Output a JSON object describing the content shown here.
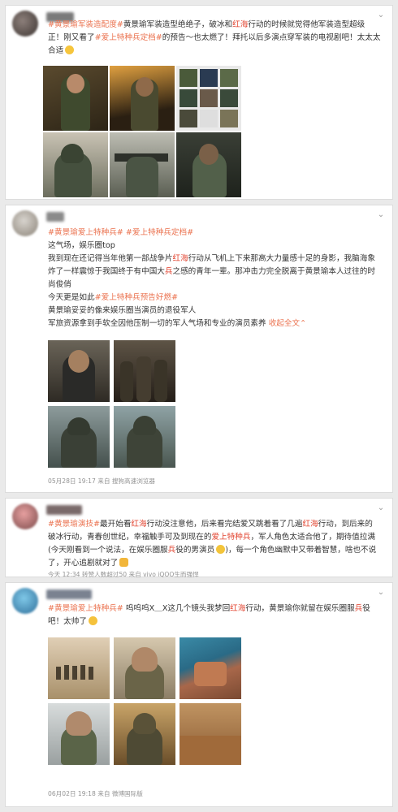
{
  "posts": [
    {
      "line1_tail": "黄景瑜军装造型绝绝子，破冰和",
      "line1_hl": "红海",
      "line1_end": "行动的时候就觉得他军装造型超级",
      "line2_pre": "正！刚又看了",
      "line2_tag": "#爱上特种兵定档#",
      "line2_post": "的预告～也太燃了！拜托以后多演点穿军装的电视剧吧！太太太",
      "line3": "合适",
      "tag1": "#黄景瑜军装造配度#"
    },
    {
      "tags": "#黄景瑜爱上特种兵# #爱上特种兵定档#",
      "l2": "这气场，娱乐圈top",
      "l3a": "我到现在还记得当年他第一部战争片",
      "l3hl": "红海",
      "l3b": "行动从飞机上下来那高大力量感十足的身影，我脑海象",
      "l4a": "炸了一样震惊于我国终于有中国大",
      "l4hl": "兵",
      "l4b": "之感的青年一辈。那冲击力完全脱离于黄景瑜本人过往的时",
      "l5": "尚俊俏",
      "l6a": "今天更是如此",
      "l6tag": "#爱上特种兵预告好燃#",
      "l7": "黄景瑜妥妥的像来娱乐圈当演员的退役军人",
      "l8a": "军旅资源拿到手软全因他压制一切的军人气场和专业的演员素养",
      "l8more": "收起全文",
      "meta": "05月28日 19:17   来自 搜狗高速浏览器"
    },
    {
      "tag1": "#黄景瑜演技#",
      "l1a": "最开始看",
      "l1hl": "红海",
      "l1b": "行动没注意他，后来看完结爱又跳着看了几遍",
      "l1hl2": "红海",
      "l1c": "行动，到后来的",
      "l2a": "破冰行动，青春创世纪，幸福触手可及到现在的",
      "l2hl": "爱上特种兵",
      "l2b": "，军人角色太适合他了，期待值拉满",
      "l3a": "(今天刚看到一个说法，在娱乐圈服",
      "l3hl": "兵",
      "l3b": "役的男演员",
      "l3c": ")，每一个角色幽默中又带着智慧，啥也不说",
      "l4": "了，开心追剧就对了",
      "meta": "今天 12:34   转赞人数超过50   来自 vivo iQOO生而强悍"
    },
    {
      "tags": "#黄景瑜爱上特种兵#",
      "l1a": "呜呜呜X＿X这几个镜头我梦回",
      "l1hl": "红海",
      "l1b": "行动，黄景瑜你就留在娱乐圈服",
      "l1hl2": "兵",
      "l1c": "役",
      "l2": "吧！太帅了",
      "meta": "06月02日 19:18   来自 微博国际版"
    }
  ],
  "icons": [
    "chevron-down-icon",
    "heart-eyes-emoji",
    "thumbs-up-emoji",
    "laughing-emoji",
    "grinning-emoji"
  ]
}
